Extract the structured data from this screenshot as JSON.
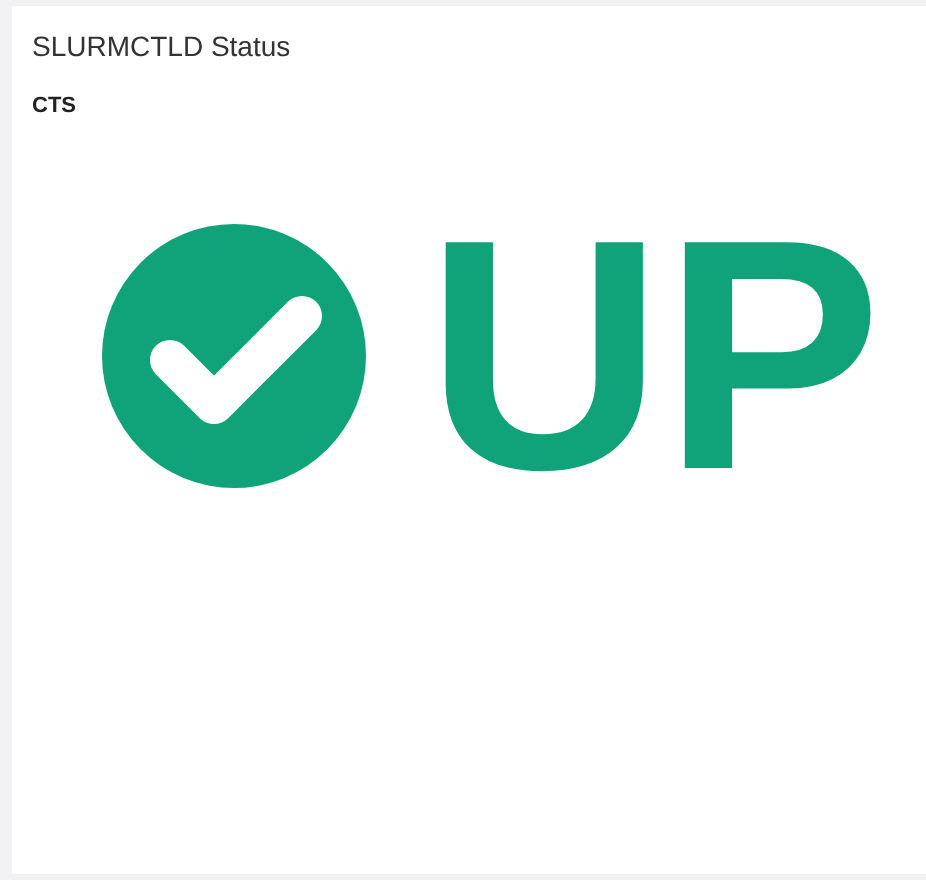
{
  "panel": {
    "title": "SLURMCTLD Status"
  },
  "host": "CTS",
  "status": {
    "kind": "up",
    "label": "UP"
  }
}
